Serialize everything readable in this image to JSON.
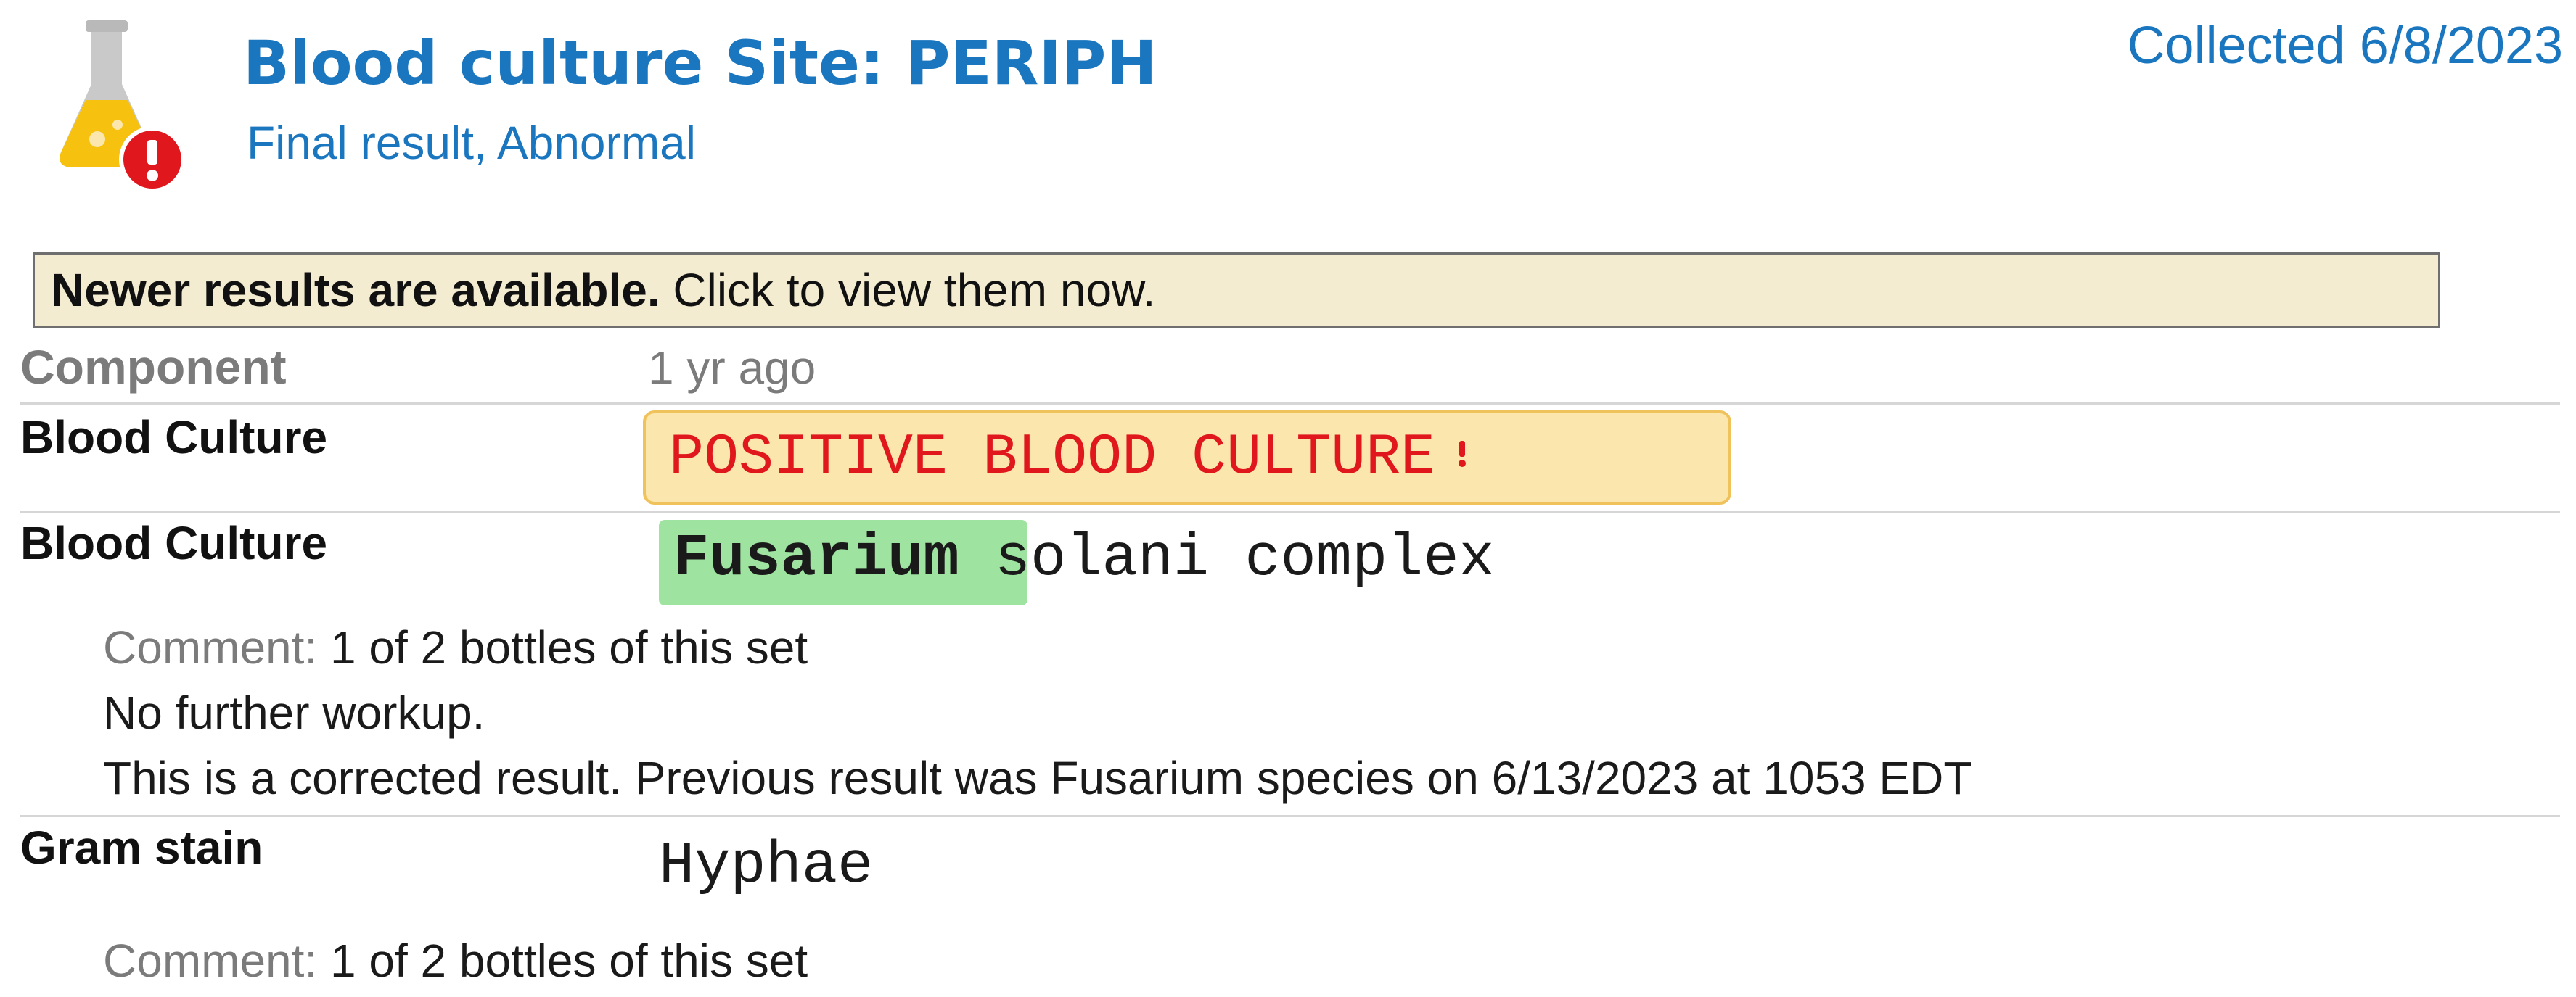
{
  "header": {
    "icon": "flask-alert-icon",
    "title": "Blood culture Site: PERIPH",
    "subtitle": "Final result, Abnormal",
    "collected": "Collected 6/8/2023"
  },
  "banner": {
    "bold_text": "Newer results are available.",
    "action_text": " Click to view them now."
  },
  "table": {
    "column_component": "Component",
    "column_date": "1 yr ago",
    "rows": [
      {
        "component": "Blood Culture",
        "value": "POSITIVE BLOOD CULTURE",
        "flag": "abnormal"
      },
      {
        "component": "Blood Culture",
        "value_highlight": "Fusarium",
        "value_rest": " solani complex",
        "comment_label": "Comment:",
        "comment_lines": [
          " 1 of 2 bottles of this set",
          "No further workup.",
          "This is a corrected result. Previous result was Fusarium species on 6/13/2023 at 1053 EDT"
        ]
      },
      {
        "component": "Gram stain",
        "value": "Hyphae",
        "comment_label": "Comment:",
        "comment_lines": [
          " 1 of 2 bottles of this set"
        ]
      }
    ]
  },
  "colors": {
    "title_blue": "#1a76bf",
    "banner_bg": "#f4ecd0",
    "positive_bg": "#fbe7ad",
    "positive_border": "#f0c25b",
    "positive_text": "#e0181d",
    "highlight_green": "#9ee3a0"
  }
}
